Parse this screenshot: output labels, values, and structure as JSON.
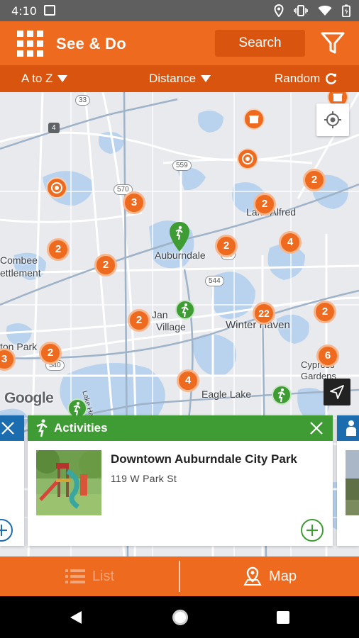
{
  "status_bar": {
    "time": "4:10",
    "icons": [
      "image-icon",
      "location-icon",
      "vibrate-icon",
      "wifi-icon",
      "battery-icon"
    ]
  },
  "header": {
    "title": "See & Do",
    "search_label": "Search",
    "menu_icon": "grid-menu-icon",
    "filter_icon": "filter-icon",
    "brand_color": "#ee6a1e",
    "brand_dark": "#d9550f"
  },
  "sort_bar": {
    "a_to_z": "A to Z",
    "distance": "Distance",
    "random": "Random"
  },
  "map": {
    "places": [
      "Lake Alfred",
      "Combee",
      "ettlement",
      "Auburndale",
      "Jan",
      "Village",
      "Winter Haven",
      "ton Park",
      "Cypress",
      "Gardens",
      "Eagle Lake"
    ],
    "roads": [
      "33",
      "4",
      "570",
      "559",
      "92",
      "544",
      "540"
    ],
    "lake_label": "Lake Hancock",
    "clusters": [
      "3",
      "2",
      "2",
      "2",
      "2",
      "4",
      "2",
      "22",
      "2",
      "2",
      "2",
      "6",
      "4",
      "3"
    ],
    "attribution": "Google"
  },
  "card": {
    "category": "Activities",
    "title": "Downtown Auburndale City Park",
    "address": "119 W Park St",
    "category_color": "#3f9c35"
  },
  "tabs": {
    "list": "List",
    "map": "Map"
  }
}
